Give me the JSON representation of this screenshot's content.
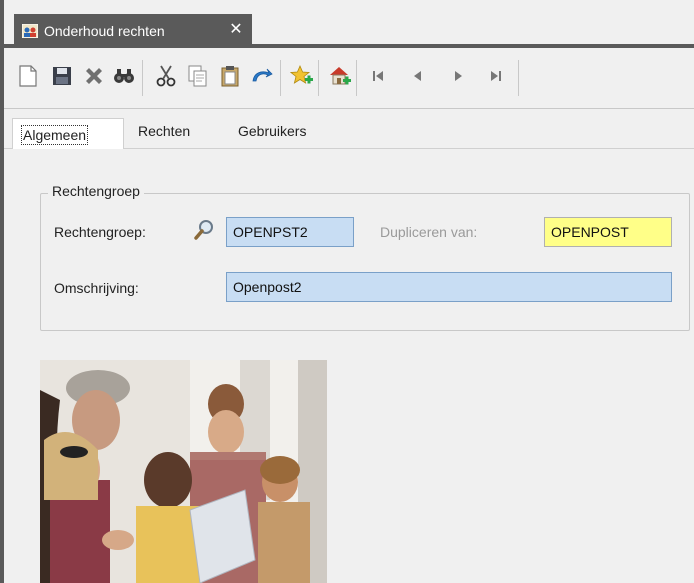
{
  "window": {
    "doc_tab_title": "Onderhoud rechten",
    "close_glyph": "✕"
  },
  "toolbar": {
    "buttons": [
      {
        "name": "new-document-icon"
      },
      {
        "name": "save-icon"
      },
      {
        "name": "delete-icon"
      },
      {
        "name": "binoculars-search-icon"
      },
      {
        "name": "cut-icon"
      },
      {
        "name": "copy-icon"
      },
      {
        "name": "paste-icon"
      },
      {
        "name": "refresh-icon"
      },
      {
        "name": "favorite-add-icon"
      },
      {
        "name": "home-add-icon"
      },
      {
        "name": "first-record-icon"
      },
      {
        "name": "previous-record-icon"
      },
      {
        "name": "next-record-icon"
      },
      {
        "name": "last-record-icon"
      }
    ]
  },
  "tabs": [
    {
      "label": "Algemeen",
      "active": true
    },
    {
      "label": "Rechten",
      "active": false
    },
    {
      "label": "Gebruikers",
      "active": false
    }
  ],
  "group": {
    "legend": "Rechtengroep",
    "rechtengroep_label": "Rechtengroep:",
    "rechtengroep_value": "OPENPST2",
    "dupliceren_label": "Dupliceren van:",
    "dupliceren_value": "OPENPOST",
    "omschrijving_label": "Omschrijving:",
    "omschrijving_value": "Openpost2"
  },
  "colors": {
    "field_blue": "#c8ddf3",
    "field_yellow": "#ffff88",
    "tab_dark": "#5a5a5a"
  }
}
